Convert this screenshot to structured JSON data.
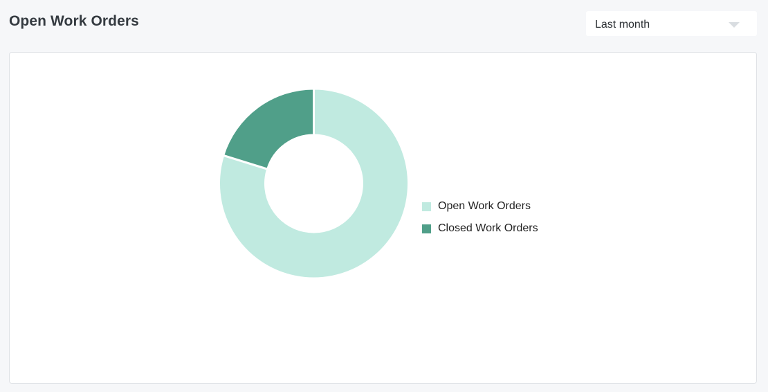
{
  "header": {
    "title": "Open Work Orders"
  },
  "period_select": {
    "value": "Last month",
    "icon": "chevron-down-icon"
  },
  "colors": {
    "open": "#c0eae0",
    "closed": "#509f89",
    "background": "#f6f7f9",
    "card": "#ffffff"
  },
  "chart_data": {
    "type": "pie",
    "variant": "donut",
    "title": "",
    "legend_position": "right",
    "slices": [
      {
        "label": "Open Work Orders",
        "value": 79.8,
        "color": "#c0eae0"
      },
      {
        "label": "Closed Work Orders",
        "value": 20.2,
        "color": "#509f89"
      }
    ]
  }
}
